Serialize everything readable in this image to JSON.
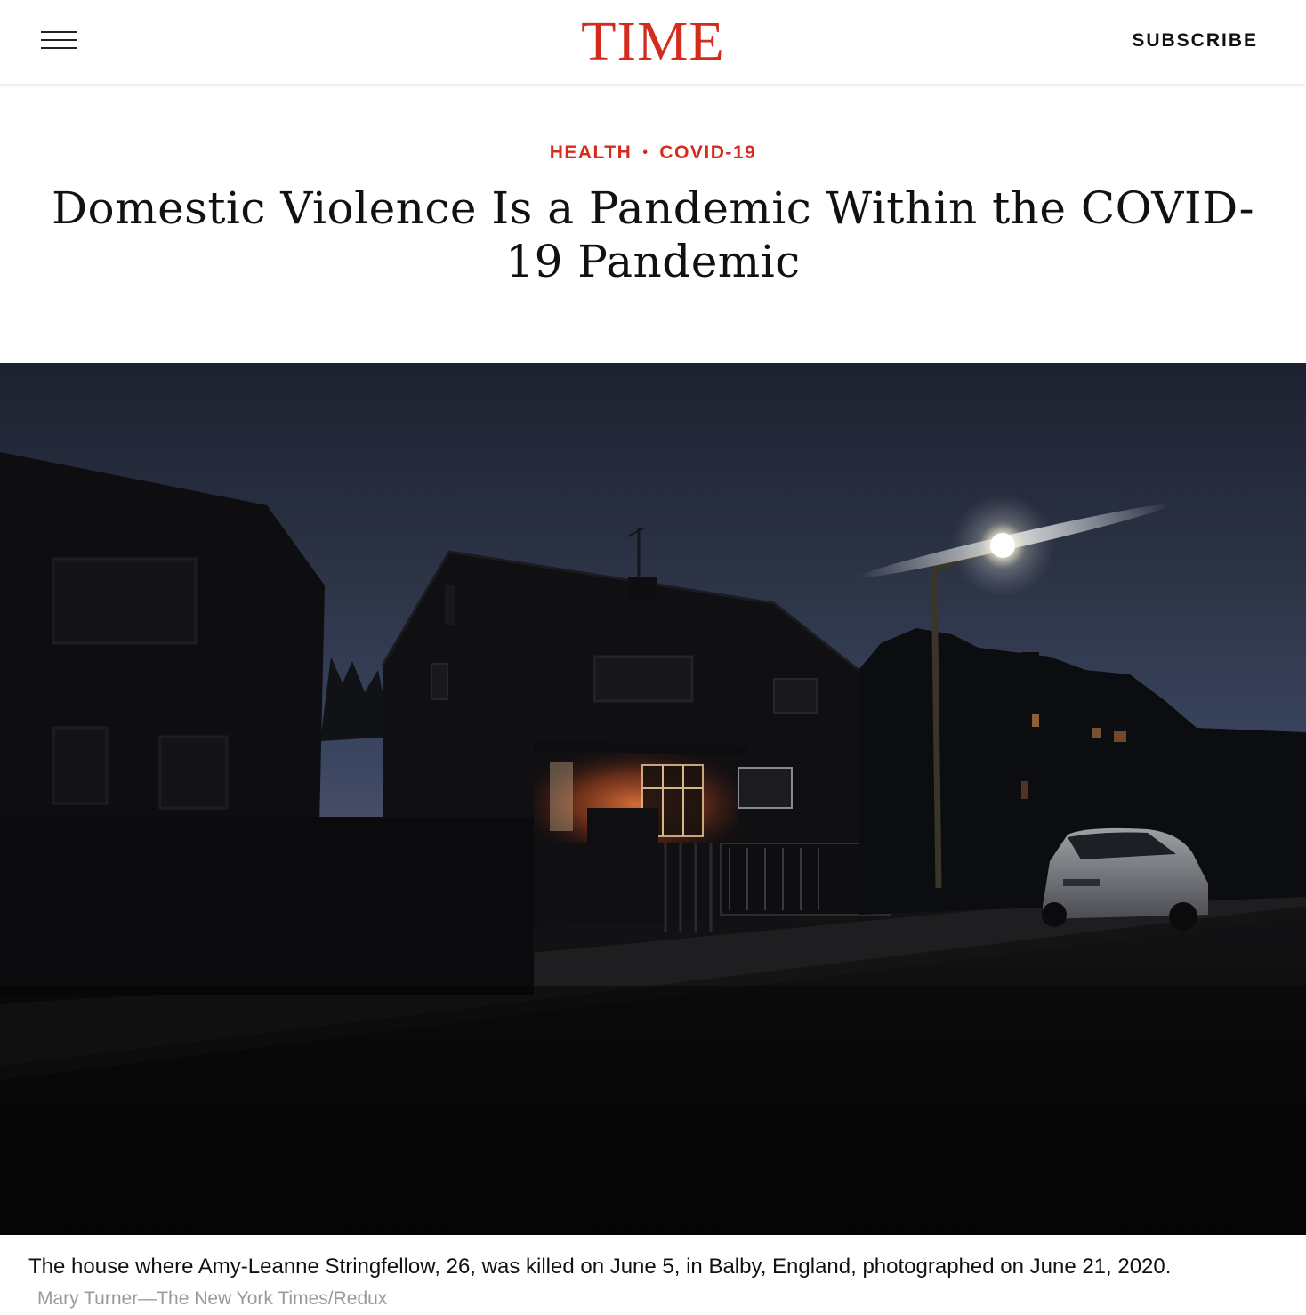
{
  "header": {
    "logo": "TIME",
    "subscribe_label": "SUBSCRIBE",
    "menu_icon": "hamburger-menu-icon",
    "brand_color": "#d52b1e"
  },
  "article": {
    "kicker": {
      "section": "HEALTH",
      "separator": "•",
      "topic": "COVID-19"
    },
    "headline": "Domestic Violence Is a Pandemic Within the COVID-19 Pandemic",
    "image": {
      "caption": "The house where Amy-Leanne Stringfellow, 26, was killed on June 5, in Balby, England, photographed on June 21, 2020.",
      "credit": "Mary Turner—The New York Times/Redux"
    }
  }
}
